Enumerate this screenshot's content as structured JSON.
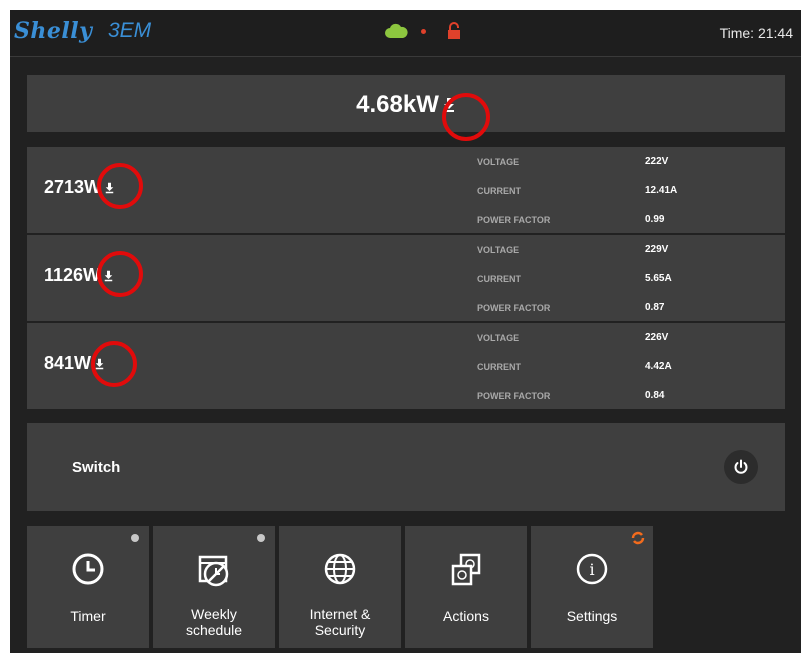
{
  "header": {
    "logo": "Shelly",
    "model": "3EM",
    "time": "Time: 21:44"
  },
  "total": {
    "power": "4.68kW"
  },
  "phases": [
    {
      "power": "2713W",
      "voltage_label": "VOLTAGE",
      "voltage": "222V",
      "current_label": "CURRENT",
      "current": "12.41A",
      "pf_label": "POWER FACTOR",
      "pf": "0.99"
    },
    {
      "power": "1126W",
      "voltage_label": "VOLTAGE",
      "voltage": "229V",
      "current_label": "CURRENT",
      "current": "5.65A",
      "pf_label": "POWER FACTOR",
      "pf": "0.87"
    },
    {
      "power": "841W",
      "voltage_label": "VOLTAGE",
      "voltage": "226V",
      "current_label": "CURRENT",
      "current": "4.42A",
      "pf_label": "POWER FACTOR",
      "pf": "0.84"
    }
  ],
  "switch": {
    "label": "Switch"
  },
  "tiles": [
    {
      "label": "Timer",
      "icon": "clock-icon"
    },
    {
      "label": "Weekly\nschedule",
      "icon": "calendar-icon"
    },
    {
      "label": "Internet &\nSecurity",
      "icon": "globe-icon"
    },
    {
      "label": "Actions",
      "icon": "actions-icon"
    },
    {
      "label": "Settings",
      "icon": "info-icon"
    }
  ],
  "colors": {
    "brand": "#3a8fd6",
    "cloud": "#8dc63f",
    "lock": "#e0412b",
    "highlight": "#e10b0b",
    "refresh": "#f26b1d"
  }
}
